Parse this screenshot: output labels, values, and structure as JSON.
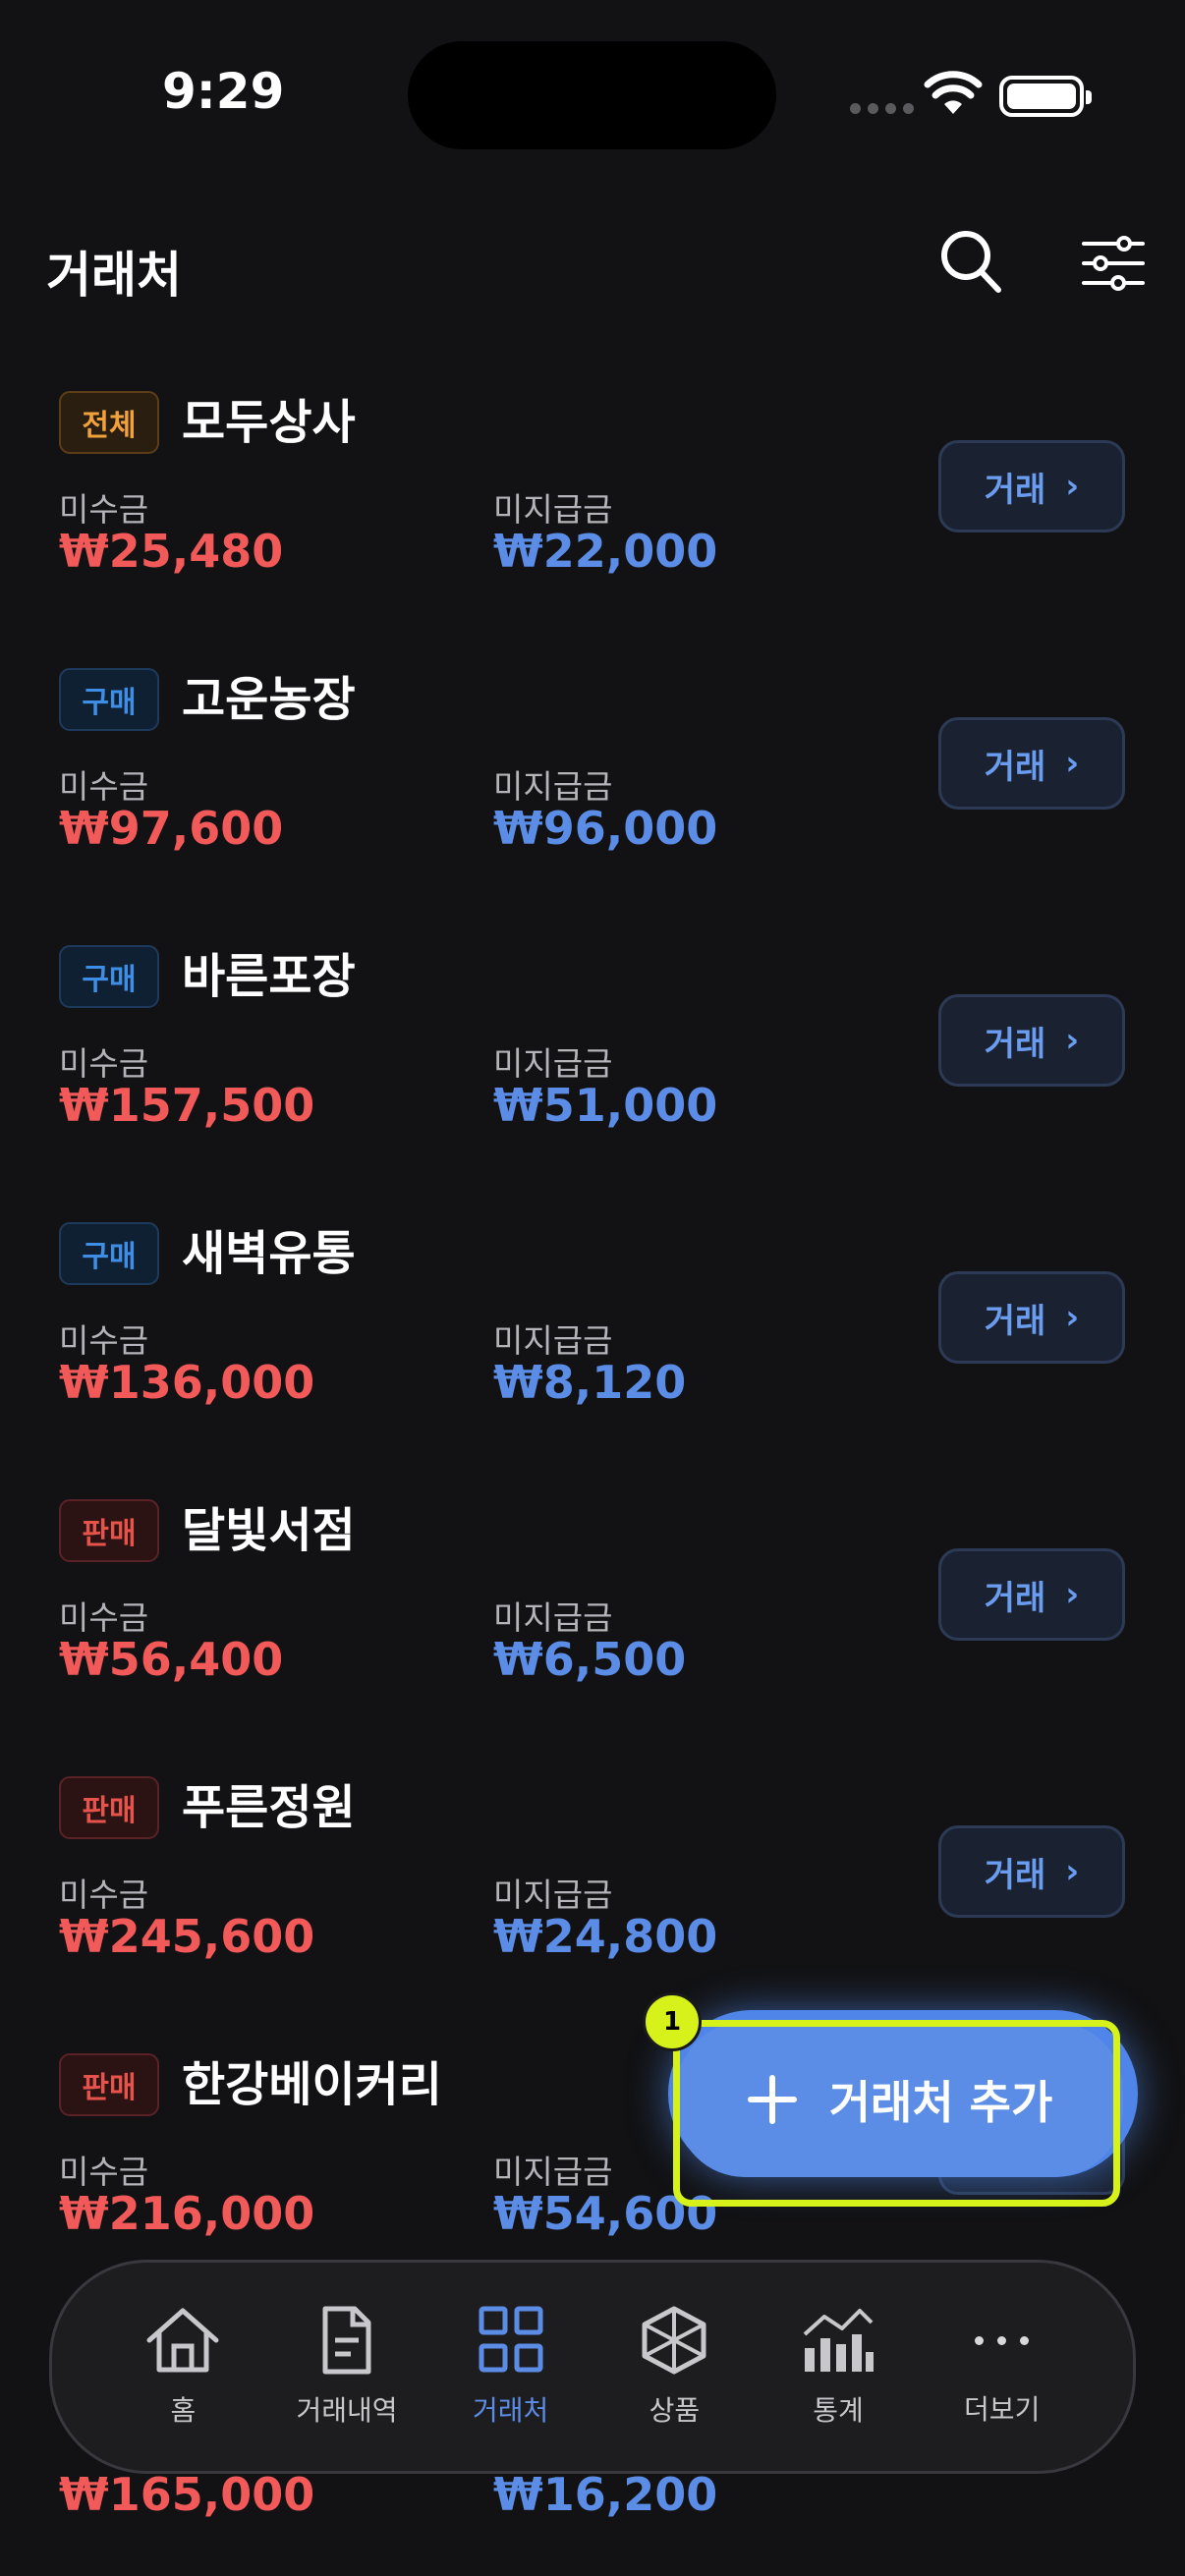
{
  "status_bar": {
    "time": "9:29"
  },
  "header": {
    "title": "거래처"
  },
  "list_labels": {
    "receivable": "미수금",
    "payable": "미지급금",
    "deal_button": "거래"
  },
  "partners": [
    {
      "badge": "전체",
      "badge_type": "all",
      "name": "모두상사",
      "receivable": "₩25,480",
      "payable": "₩22,000"
    },
    {
      "badge": "구매",
      "badge_type": "buy",
      "name": "고운농장",
      "receivable": "₩97,600",
      "payable": "₩96,000"
    },
    {
      "badge": "구매",
      "badge_type": "buy",
      "name": "바른포장",
      "receivable": "₩157,500",
      "payable": "₩51,000"
    },
    {
      "badge": "구매",
      "badge_type": "buy",
      "name": "새벽유통",
      "receivable": "₩136,000",
      "payable": "₩8,120"
    },
    {
      "badge": "판매",
      "badge_type": "sell",
      "name": "달빛서점",
      "receivable": "₩56,400",
      "payable": "₩6,500"
    },
    {
      "badge": "판매",
      "badge_type": "sell",
      "name": "푸른정원",
      "receivable": "₩245,600",
      "payable": "₩24,800"
    },
    {
      "badge": "판매",
      "badge_type": "sell",
      "name": "한강베이커리",
      "receivable": "₩216,000",
      "payable": "₩54,600"
    }
  ],
  "partial_row": {
    "receivable": "₩165,000",
    "payable": "₩16,200"
  },
  "fab": {
    "label": "거래처 추가",
    "marker": "1"
  },
  "nav": [
    {
      "label": "홈",
      "icon": "home-icon"
    },
    {
      "label": "거래내역",
      "icon": "document-icon"
    },
    {
      "label": "거래처",
      "icon": "grid-icon",
      "active": true
    },
    {
      "label": "상품",
      "icon": "cube-icon"
    },
    {
      "label": "통계",
      "icon": "chart-icon"
    },
    {
      "label": "더보기",
      "icon": "more-icon"
    }
  ],
  "colors": {
    "accent": "#5b8de6",
    "receivable": "#f25a5a",
    "highlight": "#d6f21a"
  }
}
